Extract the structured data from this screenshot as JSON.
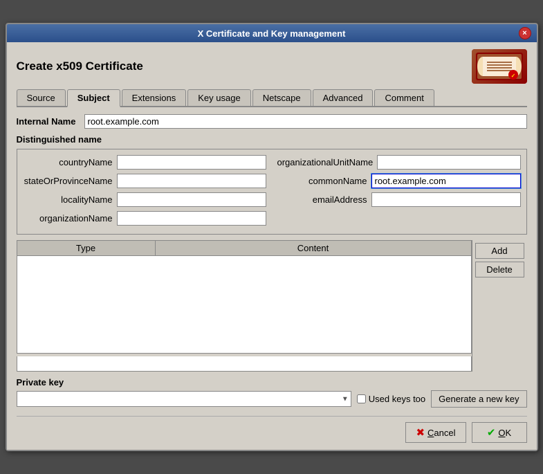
{
  "window": {
    "title": "X Certificate and Key management",
    "close_button": "×"
  },
  "header": {
    "title": "Create x509 Certificate"
  },
  "tabs": [
    {
      "id": "source",
      "label": "Source"
    },
    {
      "id": "subject",
      "label": "Subject",
      "active": true
    },
    {
      "id": "extensions",
      "label": "Extensions"
    },
    {
      "id": "key_usage",
      "label": "Key usage"
    },
    {
      "id": "netscape",
      "label": "Netscape"
    },
    {
      "id": "advanced",
      "label": "Advanced"
    },
    {
      "id": "comment",
      "label": "Comment"
    }
  ],
  "internal_name": {
    "label": "Internal Name",
    "value": "root.example.com",
    "placeholder": ""
  },
  "distinguished_name": {
    "label": "Distinguished name",
    "fields": {
      "countryName": {
        "label": "countryName",
        "value": "",
        "placeholder": ""
      },
      "stateOrProvinceName": {
        "label": "stateOrProvinceName",
        "value": "",
        "placeholder": ""
      },
      "localityName": {
        "label": "localityName",
        "value": "",
        "placeholder": ""
      },
      "organizationName": {
        "label": "organizationName",
        "value": "",
        "placeholder": ""
      },
      "organizationalUnitName": {
        "label": "organizationalUnitName",
        "value": "",
        "placeholder": ""
      },
      "commonName": {
        "label": "commonName",
        "value": "root.example.com",
        "placeholder": ""
      },
      "emailAddress": {
        "label": "emailAddress",
        "value": "",
        "placeholder": ""
      }
    }
  },
  "table": {
    "columns": [
      {
        "id": "type",
        "label": "Type"
      },
      {
        "id": "content",
        "label": "Content"
      }
    ],
    "rows": [],
    "add_button": "Add",
    "delete_button": "Delete"
  },
  "private_key": {
    "label": "Private key",
    "used_keys_label": "Used keys too",
    "generate_button": "Generate a new key",
    "select_placeholder": ""
  },
  "buttons": {
    "cancel": "Cancel",
    "ok": "OK",
    "cancel_underline_index": 0,
    "ok_underline_index": 0
  }
}
